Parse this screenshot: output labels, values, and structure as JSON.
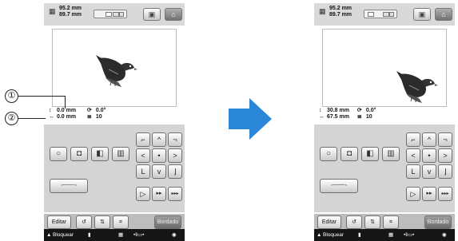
{
  "before": {
    "size": {
      "width": "95.2 mm",
      "height": "89.7 mm"
    },
    "position": {
      "y": "0.0 mm",
      "x": "0.0 mm",
      "rotation": "0.0°",
      "colors": "10"
    }
  },
  "after": {
    "size": {
      "width": "95.2 mm",
      "height": "89.7 mm"
    },
    "position": {
      "y": "30.8 mm",
      "x": "67.5 mm",
      "rotation": "0.0°",
      "colors": "10"
    }
  },
  "callouts": {
    "one": "①",
    "two": "②"
  },
  "buttons": {
    "edit": "Editar",
    "finish": "Bordado",
    "lock": "Bloquear",
    "up": "^",
    "down": "v",
    "left": "<",
    "right": ">",
    "center": "•",
    "play": "▷",
    "ff": "▸▸",
    "fff": "▸▸▸"
  },
  "symbols": {
    "y_axis": "↕",
    "x_axis": "↔",
    "rotation": "⟳",
    "colors": "≣",
    "dim_icon": "▦",
    "undo": "↺",
    "home": "⌂"
  },
  "colors": {
    "arrow": "#2a86d6",
    "status_bar": "#151515"
  }
}
